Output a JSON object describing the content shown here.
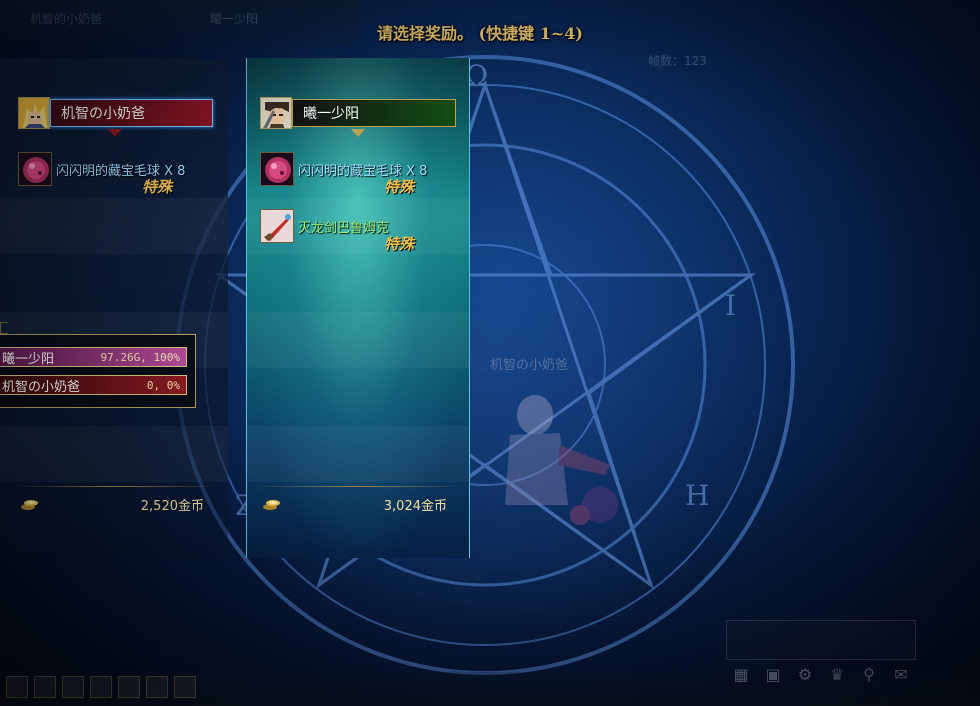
{
  "header": {
    "title": "请选择奖励。 (快捷键 1~4)",
    "faint_right": "帧数：123",
    "faint_left_a": "机智的小奶爸",
    "faint_left_b": "曦一少阳"
  },
  "players": [
    {
      "name": "机智の小奶爸",
      "plate_color": "#8e1626",
      "rewards": [
        {
          "name": "闪闪明的藏宝毛球 X 8",
          "tag": "特殊",
          "icon": "fur-ball-icon"
        }
      ],
      "gold": "2,520金币"
    },
    {
      "name": "曦一少阳",
      "plate_color": "#134d15",
      "rewards": [
        {
          "name": "闪闪明的藏宝毛球 X 8",
          "tag": "特殊",
          "icon": "fur-ball-icon"
        },
        {
          "name": "灭龙剑巴鲁姆克",
          "tag": "特殊",
          "icon": "sword-icon"
        }
      ],
      "gold": "3,024金币"
    }
  ],
  "roll_results": [
    {
      "name": "曦一少阳",
      "value": "97.26G, 100%"
    },
    {
      "name": "机智の小奶爸",
      "value": "0, 0%"
    }
  ],
  "scene": {
    "ghost_name": "机智の小奶爸"
  }
}
